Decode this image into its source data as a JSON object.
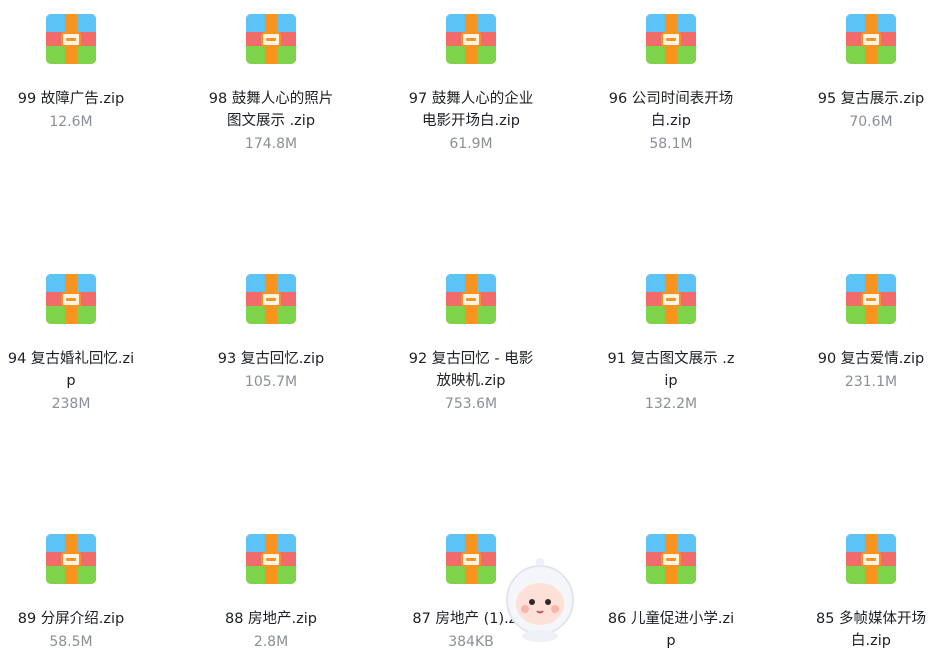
{
  "files": [
    {
      "name": "99 故障广告.zip",
      "size": "12.6M",
      "icon": "zip-archive-icon"
    },
    {
      "name": "98 鼓舞人心的照片图文展示 .zip",
      "size": "174.8M",
      "icon": "zip-archive-icon"
    },
    {
      "name": "97 鼓舞人心的企业电影开场白.zip",
      "size": "61.9M",
      "icon": "zip-archive-icon"
    },
    {
      "name": "96 公司时间表开场白.zip",
      "size": "58.1M",
      "icon": "zip-archive-icon"
    },
    {
      "name": "95 复古展示.zip",
      "size": "70.6M",
      "icon": "zip-archive-icon"
    },
    {
      "name": "94 复古婚礼回忆.zip",
      "size": "238M",
      "icon": "zip-archive-icon"
    },
    {
      "name": "93 复古回忆.zip",
      "size": "105.7M",
      "icon": "zip-archive-icon"
    },
    {
      "name": "92 复古回忆 - 电影放映机.zip",
      "size": "753.6M",
      "icon": "zip-archive-icon"
    },
    {
      "name": "91 复古图文展示 .zip",
      "size": "132.2M",
      "icon": "zip-archive-icon"
    },
    {
      "name": "90 复古爱情.zip",
      "size": "231.1M",
      "icon": "zip-archive-icon"
    },
    {
      "name": "89 分屏介绍.zip",
      "size": "58.5M",
      "icon": "zip-archive-icon"
    },
    {
      "name": "88 房地产.zip",
      "size": "2.8M",
      "icon": "zip-archive-icon"
    },
    {
      "name": "87 房地产 (1).zip",
      "size": "384KB",
      "icon": "zip-archive-icon"
    },
    {
      "name": "86 儿童促进小学.zip",
      "size": "",
      "icon": "zip-archive-icon"
    },
    {
      "name": "85 多帧媒体开场白.zip",
      "size": "",
      "icon": "zip-archive-icon"
    }
  ],
  "colors": {
    "icon_top": "#5bc3f5",
    "icon_middle": "#f26b6b",
    "icon_bottom": "#7dd44a",
    "icon_strap": "#f7941d",
    "text": "#1c1f26",
    "meta": "#8a8f99"
  },
  "overlay": {
    "icon": "astronaut-mascot-icon"
  }
}
